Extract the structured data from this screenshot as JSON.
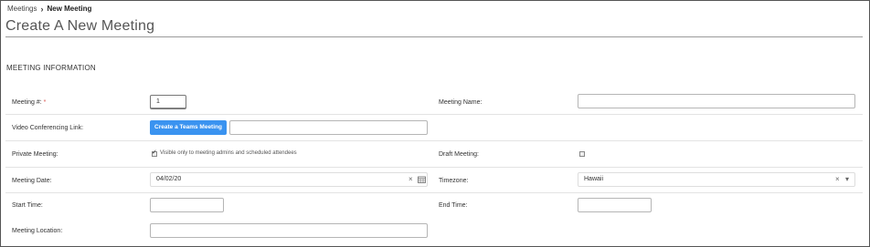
{
  "breadcrumb": {
    "parent": "Meetings",
    "current": "New Meeting"
  },
  "page_title": "Create A New Meeting",
  "section_title": "MEETING INFORMATION",
  "form": {
    "meeting_number": {
      "label": "Meeting #:",
      "required_mark": "*",
      "value": "1"
    },
    "meeting_name": {
      "label": "Meeting Name:",
      "value": ""
    },
    "video_link": {
      "label": "Video Conferencing Link:",
      "button_label": "Create a Teams Meeting",
      "value": ""
    },
    "private_meeting": {
      "label": "Private Meeting:",
      "checkbox_label": "Visible only to meeting admins and scheduled attendees",
      "checked": true
    },
    "draft_meeting": {
      "label": "Draft Meeting:",
      "checked": false
    },
    "meeting_date": {
      "label": "Meeting Date:",
      "value": "04/02/20",
      "clear_glyph": "×",
      "calendar_icon": "calendar-icon"
    },
    "timezone": {
      "label": "Timezone:",
      "value": "Hawaii",
      "clear_glyph": "×",
      "dropdown_glyph": "▾"
    },
    "start_time": {
      "label": "Start Time:",
      "value": ""
    },
    "end_time": {
      "label": "End Time:",
      "value": ""
    },
    "meeting_location": {
      "label": "Meeting Location:",
      "value": ""
    }
  },
  "colors": {
    "accent": "#3a93f0",
    "required": "#d9534f"
  }
}
